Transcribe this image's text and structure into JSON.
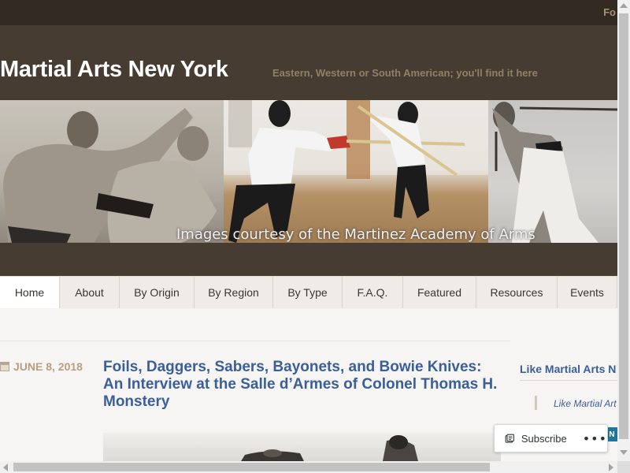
{
  "topbar": {
    "follow_label": "Fo"
  },
  "header": {
    "site_title": "Martial Arts New York",
    "tagline": "Eastern, Western or South American; you'll find it here",
    "banner_caption": "Images courtesy of the Martinez Academy of Arms"
  },
  "nav": {
    "items": [
      {
        "label": "Home"
      },
      {
        "label": "About"
      },
      {
        "label": "By Origin"
      },
      {
        "label": "By Region"
      },
      {
        "label": "By Type"
      },
      {
        "label": "F.A.Q."
      },
      {
        "label": "Featured"
      },
      {
        "label": "Resources"
      },
      {
        "label": "Events"
      }
    ],
    "active_item": "Home"
  },
  "post": {
    "date": "JUNE 8, 2018",
    "title": "Foils, Daggers, Sabers, Bayonets, and Bowie Knives: An Interview at the Salle d’Armes of Colonel Thomas H. Monstery"
  },
  "sidebar": {
    "widget_title": "Like Martial Arts N",
    "widget_link": "Like Martial Art",
    "badge_text": "N"
  },
  "subscribe": {
    "label": "Subscribe",
    "more": "•••",
    "icon": "subscribe-reader-icon"
  },
  "colors": {
    "topbar": "#322a23",
    "header": "#463c32",
    "title_text": "#ffffff",
    "tagline_text": "#8f8166",
    "link_blue": "#3a5f98",
    "date_text": "#b99d80"
  }
}
